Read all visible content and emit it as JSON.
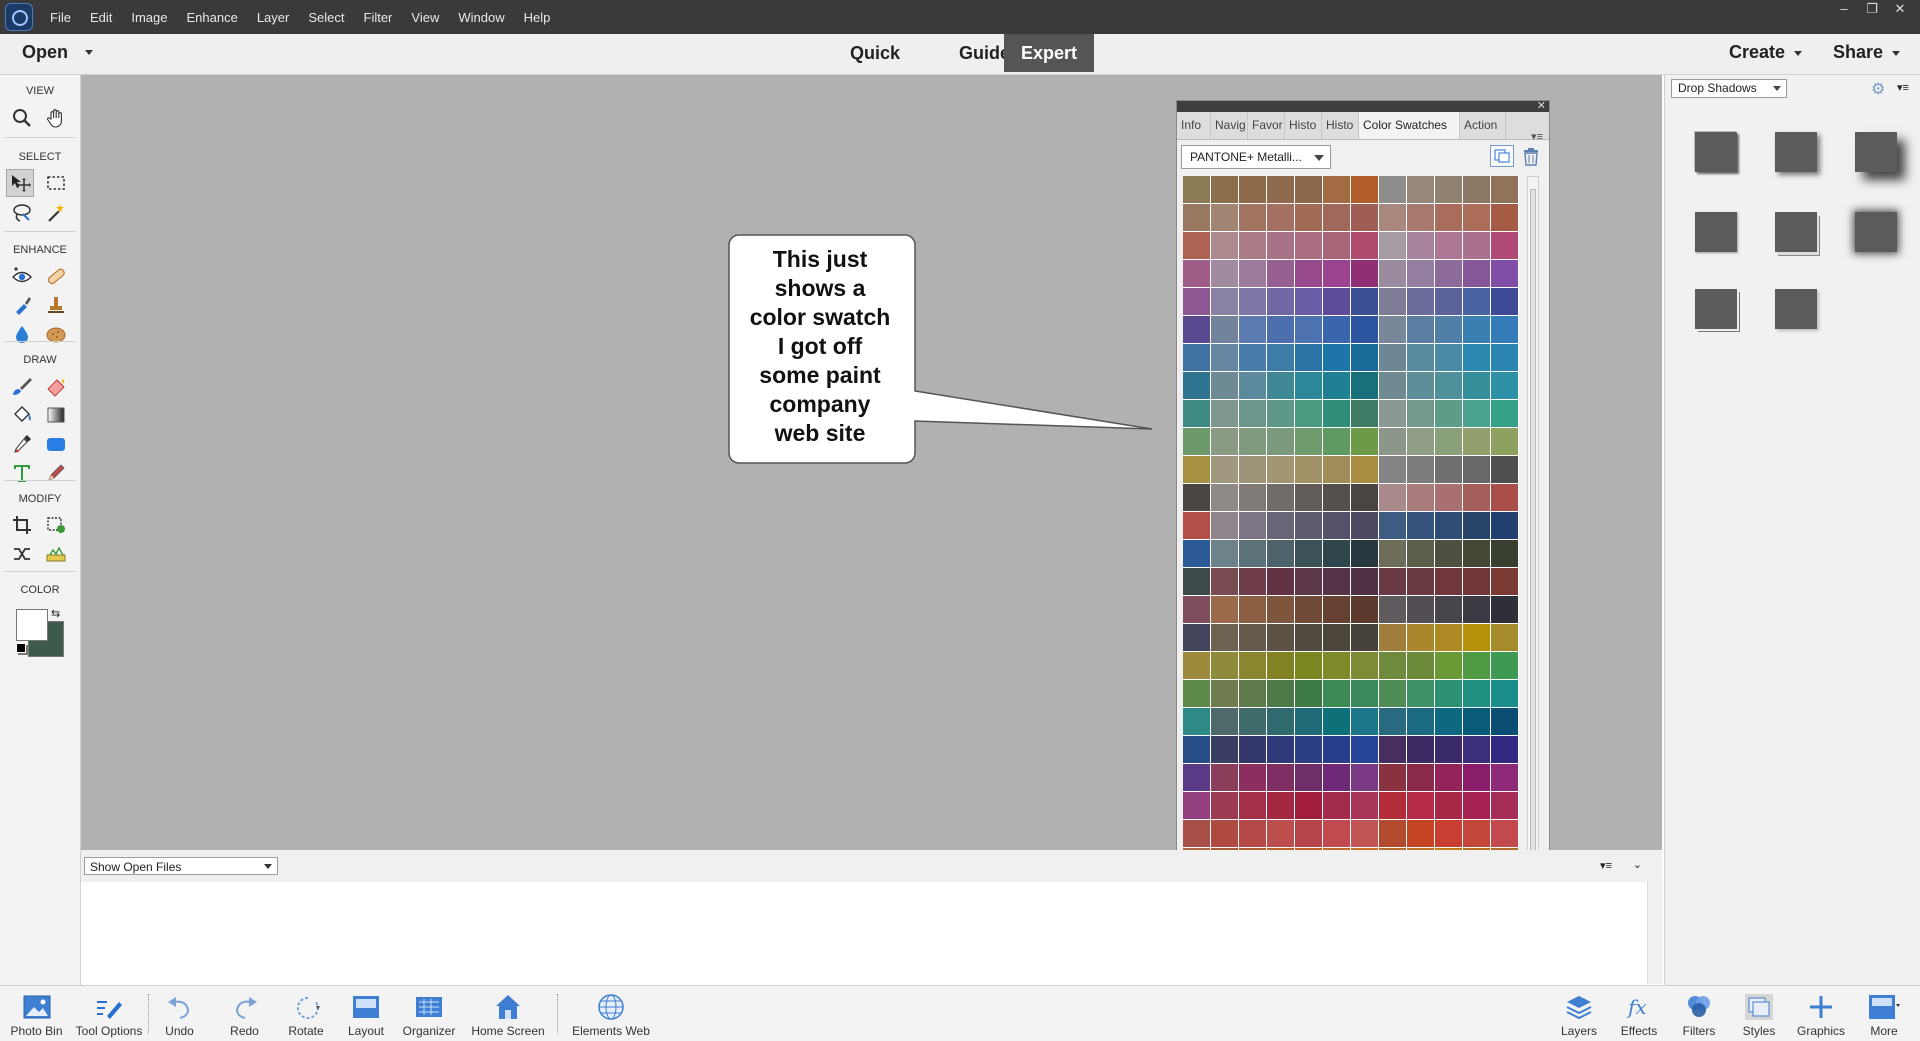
{
  "menubar": {
    "items": [
      "File",
      "Edit",
      "Image",
      "Enhance",
      "Layer",
      "Select",
      "Filter",
      "View",
      "Window",
      "Help"
    ],
    "window_controls": [
      "–",
      "❐",
      "✕"
    ]
  },
  "modebar": {
    "open_label": "Open",
    "modes": [
      "Quick",
      "Guided",
      "Expert"
    ],
    "active_mode": "Expert",
    "create_label": "Create",
    "share_label": "Share"
  },
  "toolbox": {
    "sections": [
      "VIEW",
      "SELECT",
      "ENHANCE",
      "DRAW",
      "MODIFY",
      "COLOR"
    ],
    "colors": {
      "foreground": "#ffffff",
      "background": "#3d5a4a"
    }
  },
  "bin": {
    "show_open_files": "Show Open Files"
  },
  "callout": {
    "lines": [
      "This just",
      "shows a",
      "color swatch",
      "I got off",
      "some paint",
      "company",
      "web site"
    ]
  },
  "swatches": {
    "tabs": [
      "Info",
      "Navig",
      "Favor",
      "Histo",
      "Histo",
      "Color Swatches",
      "Action"
    ],
    "active_tab": "Color Swatches",
    "library": "PANTONE+ Metalli...",
    "columns": 12,
    "colors": [
      "#8c7a55",
      "#8d6e4a",
      "#8c6a4a",
      "#8e6a4e",
      "#8b674b",
      "#a36b42",
      "#b35d2b",
      "#8d8d8d",
      "#98887a",
      "#8f8270",
      "#8c7764",
      "#8f735a",
      "#997861",
      "#a18472",
      "#a07460",
      "#a47061",
      "#a06a55",
      "#a0685a",
      "#9f5e55",
      "#a8887c",
      "#a87a6f",
      "#a96d5e",
      "#ab6d58",
      "#a65b44",
      "#ad6252",
      "#ad8a8e",
      "#a97c86",
      "#a87287",
      "#ab6e84",
      "#a86577",
      "#b04a6f",
      "#a69aa3",
      "#a7849c",
      "#ae7895",
      "#a9718d",
      "#b04976",
      "#9e5c87",
      "#a18b9f",
      "#9b7a9c",
      "#965f92",
      "#964a8c",
      "#9c4390",
      "#902f76",
      "#9a8c9e",
      "#937ea0",
      "#8c6a9a",
      "#855798",
      "#814ea6",
      "#8c5793",
      "#8a82a2",
      "#7e76a4",
      "#6f68a4",
      "#6b5ca6",
      "#5e4b9a",
      "#3a4f94",
      "#7f7c98",
      "#6c6c9a",
      "#5b629c",
      "#4b63a3",
      "#3c4a98",
      "#5a4990",
      "#72849c",
      "#5b7bb0",
      "#4c6eac",
      "#4e71b0",
      "#3b66ad",
      "#2d54a0",
      "#788799",
      "#5a7ea2",
      "#517fa8",
      "#3a7fb1",
      "#347cb8",
      "#3f71a1",
      "#6686a2",
      "#4a7ca9",
      "#3d7ca6",
      "#2a74a6",
      "#1d75a8",
      "#1a6b9a",
      "#6d8797",
      "#578a9f",
      "#4b8aa5",
      "#2c8ab0",
      "#2a85b2",
      "#2f7591",
      "#6e8b95",
      "#5a8a9c",
      "#3f8895",
      "#2c8798",
      "#1f8093",
      "#18707a",
      "#6f8a90",
      "#5e8e98",
      "#4f919b",
      "#36909c",
      "#2e91a5",
      "#3f8b83",
      "#7e978f",
      "#6a968c",
      "#5d9888",
      "#4a9a82",
      "#2f8d78",
      "#3e7c65",
      "#8a9a92",
      "#72998b",
      "#5c9c88",
      "#4ba38d",
      "#35a085",
      "#6c9a6a",
      "#8b9b83",
      "#7f9a7c",
      "#7b997b",
      "#6e9a6d",
      "#5f9a63",
      "#6d9a46",
      "#8d968a",
      "#8f9e84",
      "#8aa07a",
      "#93a06d",
      "#8ea25f",
      "#a89043",
      "#a0987e",
      "#9e9478",
      "#a19572",
      "#a39168",
      "#a08d57",
      "#a88c3f",
      "#848484",
      "#7c7c7c",
      "#707070",
      "#686868",
      "#4f4f4f",
      "#4b4642",
      "#8e8a86",
      "#807a76",
      "#716c69",
      "#615c58",
      "#55504c",
      "#4b4541",
      "#a88a8b",
      "#a87c7c",
      "#a87070",
      "#a6605c",
      "#a94e49",
      "#b24f48",
      "#8d848c",
      "#7c7586",
      "#6a6479",
      "#5f5b70",
      "#54526a",
      "#4c4b63",
      "#3e5b82",
      "#36547c",
      "#2f4d74",
      "#284469",
      "#214070",
      "#2b5a96",
      "#6e8289",
      "#5b7378",
      "#4c6469",
      "#3b5257",
      "#2f464c",
      "#27393f",
      "#6d6e5a",
      "#5c5e4c",
      "#4e5142",
      "#434837",
      "#3a4031",
      "#3c4b4a",
      "#7a4a52",
      "#6e3d49",
      "#623345",
      "#5d3849",
      "#553447",
      "#503145",
      "#6a3a44",
      "#6a3a42",
      "#70383d",
      "#713637",
      "#7a3a34",
      "#7e4d5e",
      "#9a6a4a",
      "#8b5e42",
      "#7e563e",
      "#6f4a36",
      "#664131",
      "#5c3b2e",
      "#5e5a5e",
      "#524e54",
      "#49454d",
      "#3d3a44",
      "#2f2f3a",
      "#41445a",
      "#6e6252",
      "#655a4c",
      "#5c5246",
      "#524a40",
      "#4c463c",
      "#46413a",
      "#9e7e3a",
      "#a8872d",
      "#ae8a24",
      "#b8910a",
      "#a68b2a",
      "#9e8a3c",
      "#8e8a3c",
      "#8a8630",
      "#808224",
      "#7c8620",
      "#7e8a2a",
      "#7e8a36",
      "#6f8a3c",
      "#6c8a3a",
      "#6a9a36",
      "#4e9a42",
      "#3c9a52",
      "#5e8a4a",
      "#6e7c4e",
      "#5e7a4a",
      "#4e7a4a",
      "#3e7a46",
      "#3e8a54",
      "#3a8a5c",
      "#4f8c56",
      "#3e9066",
      "#2c9072",
      "#1e8f80",
      "#1a8e8a",
      "#2e8a86",
      "#4e6a6a",
      "#3e6a6a",
      "#2e6a6e",
      "#1e6a76",
      "#0e7078",
      "#1a7688",
      "#2a6a80",
      "#1a6a82",
      "#0e6880",
      "#0a5a7a",
      "#0a4e74",
      "#284e88",
      "#3a3e62",
      "#34386a",
      "#2e3a7a",
      "#2c3e84",
      "#283e8a",
      "#26449a",
      "#462e60",
      "#3e2a62",
      "#3a2a6a",
      "#3c2e7a",
      "#322a80",
      "#5a3a86",
      "#8a3e5a",
      "#8c2e5e",
      "#7e2e62",
      "#6e2e68",
      "#6e2a78",
      "#7a3a84",
      "#8a3240",
      "#8a2a48",
      "#92245a",
      "#8a1e6a",
      "#8e2a78",
      "#94407e",
      "#9c3a52",
      "#a23048",
      "#a22842",
      "#a21c3e",
      "#a22c4a",
      "#a83458",
      "#b22c3a",
      "#b42a48",
      "#a82848",
      "#a62252",
      "#a62c58",
      "#a85048",
      "#ae4a40",
      "#b44a48",
      "#bc4e4e",
      "#b4444a",
      "#c04a50",
      "#c25656",
      "#b24a2e",
      "#c44424",
      "#c83e30",
      "#c2463a",
      "#c24a4e",
      "#ae6440",
      "#a85c34",
      "#b05c2c",
      "#b8602a",
      "#c05e26",
      "#c06a2a",
      "#c8702a",
      "#b66a2a",
      "#c07020",
      "#c27a14",
      "#b66e22",
      "#b06a2a"
    ]
  },
  "stylespanel": {
    "category": "Drop Shadows"
  },
  "taskbar": {
    "left": [
      "Photo Bin",
      "Tool Options",
      "Undo",
      "Redo",
      "Rotate",
      "Layout",
      "Organizer",
      "Home Screen",
      "Elements Web"
    ],
    "right": [
      "Layers",
      "Effects",
      "Filters",
      "Styles",
      "Graphics",
      "More"
    ]
  }
}
